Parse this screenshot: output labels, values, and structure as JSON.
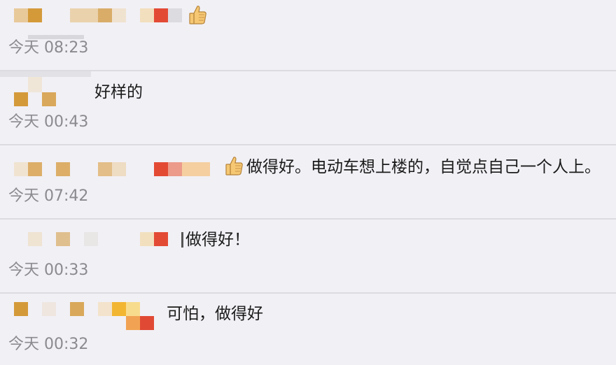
{
  "comments": [
    {
      "time": "今天 08:23",
      "text": "",
      "has_emoji": true,
      "emoji_icon": "thumbs-up-icon"
    },
    {
      "time": "今天 00:43",
      "text": "好样的"
    },
    {
      "time": "今天 07:42",
      "text": "做得好。电动车想上楼的，自觉点自己一个人上。",
      "emoji_icon": "thumbs-up-icon"
    },
    {
      "time": "今天 00:33",
      "text": "做得好！"
    },
    {
      "time": "今天 00:32",
      "text": "可怕，做得好"
    }
  ],
  "colors": {
    "background": "#f1f0f5",
    "divider": "#dcdbe0",
    "timestamp": "#8a8a8f",
    "text": "#1b1b1b"
  }
}
